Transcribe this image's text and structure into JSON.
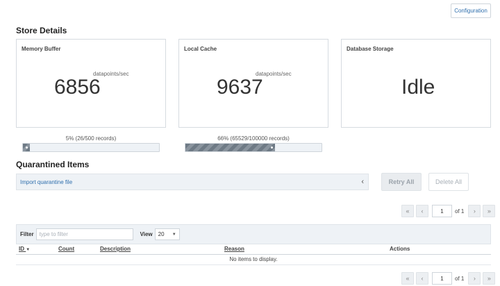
{
  "header": {
    "configuration_label": "Configuration"
  },
  "store_details": {
    "title": "Store Details",
    "cards": [
      {
        "title": "Memory Buffer",
        "unit": "datapoints/sec",
        "value": "6856"
      },
      {
        "title": "Local Cache",
        "unit": "datapoints/sec",
        "value": "9637"
      },
      {
        "title": "Database Storage",
        "unit": "",
        "value": "Idle"
      }
    ],
    "progress": [
      {
        "label": "5% (26/500 records)",
        "fraction": 0.05
      },
      {
        "label": "66% (65529/100000 records)",
        "fraction": 0.66
      }
    ]
  },
  "quarantine": {
    "title": "Quarantined Items",
    "import_label": "Import quarantine file",
    "retry_all_label": "Retry All",
    "delete_all_label": "Delete All",
    "pager": {
      "first": "«",
      "prev": "‹",
      "page": "1",
      "of_label": "of 1",
      "next": "›",
      "last": "»"
    },
    "filter": {
      "label": "Filter",
      "placeholder": "type to filter",
      "view_label": "View",
      "view_value": "20"
    },
    "columns": [
      "ID",
      "Count",
      "Description",
      "Reason",
      "Actions"
    ],
    "empty_text": "No items to display."
  },
  "icons": {
    "collapse": "chevron-left-icon",
    "sort": "sort-desc-icon",
    "select": "caret-down-icon"
  }
}
